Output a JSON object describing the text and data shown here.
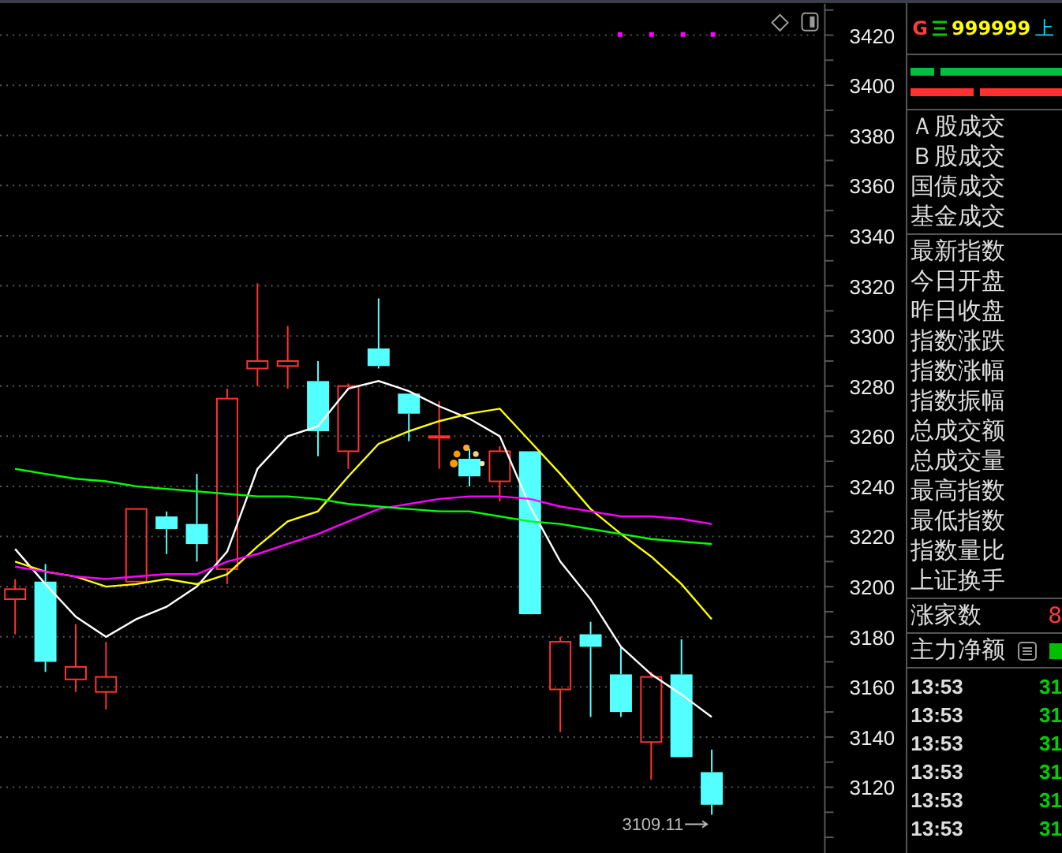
{
  "chart": {
    "chart_data": {
      "type": "candlestick",
      "grid": true,
      "ylim": [
        3094,
        3432.5
      ],
      "yticks": [
        3120,
        3140,
        3160,
        3180,
        3200,
        3220,
        3240,
        3260,
        3280,
        3300,
        3320,
        3340,
        3360,
        3380,
        3400,
        3420
      ],
      "ohlc": [
        [
          3195,
          3203,
          3181,
          3199
        ],
        [
          3202,
          3209,
          3166,
          3170
        ],
        [
          3163,
          3185,
          3158,
          3168
        ],
        [
          3158,
          3178,
          3151,
          3164
        ],
        [
          3202,
          3231,
          3202,
          3231
        ],
        [
          3228,
          3230,
          3213,
          3223
        ],
        [
          3225,
          3245,
          3210,
          3217
        ],
        [
          3207,
          3279,
          3201,
          3275
        ],
        [
          3287,
          3321,
          3280,
          3290
        ],
        [
          3288,
          3304,
          3279,
          3290
        ],
        [
          3282,
          3290,
          3252,
          3262
        ],
        [
          3254,
          3281,
          3247,
          3280
        ],
        [
          3295,
          3315,
          3287,
          3288
        ],
        [
          3277,
          3277,
          3258,
          3269
        ],
        [
          3260,
          3274,
          3247,
          3260
        ],
        [
          3251,
          3255,
          3240,
          3244
        ],
        [
          3242,
          3256,
          3234,
          3254
        ],
        [
          3254,
          3254,
          3189,
          3189
        ],
        [
          3159,
          3180,
          3142,
          3178
        ],
        [
          3181,
          3186,
          3148,
          3176
        ],
        [
          3165,
          3176,
          3148,
          3150
        ],
        [
          3138,
          3166,
          3123,
          3164
        ],
        [
          3165,
          3179,
          3132,
          3132
        ],
        [
          3126,
          3135,
          3109,
          3113
        ],
        null,
        null,
        null
      ],
      "series": [
        {
          "type": "line",
          "color": "#ffffff",
          "values": [
            3215,
            3201,
            3188,
            3180,
            3187,
            3192,
            3200,
            3214,
            3247,
            3260,
            3264,
            3279,
            3282,
            3278,
            3272,
            3267,
            3260,
            3232,
            3210,
            3195,
            3176,
            3165,
            3157,
            3148,
            null,
            null,
            null
          ]
        },
        {
          "type": "line",
          "color": "#ffff00",
          "values": [
            3210,
            3206,
            3204,
            3200,
            3201,
            3203,
            3201,
            3205,
            3216,
            3226,
            3230,
            3244,
            3257,
            3262,
            3266,
            3269,
            3271,
            3258,
            3245,
            3231,
            3221,
            3212,
            3201,
            3187,
            null,
            null,
            null
          ]
        },
        {
          "type": "line",
          "color": "#ff00ff",
          "values": [
            3208,
            3206,
            3204,
            3203,
            3204,
            3205,
            3205,
            3210,
            3213,
            3217,
            3221,
            3226,
            3231,
            3233,
            3235,
            3236,
            3236,
            3235,
            3232,
            3230,
            3228,
            3228,
            3227,
            3225,
            null,
            null,
            null
          ]
        },
        {
          "type": "line",
          "color": "#00ff00",
          "values": [
            3247,
            3245,
            3243,
            3242,
            3240,
            3239,
            3238,
            3237,
            3236,
            3236,
            3235,
            3233,
            3232,
            3231,
            3230,
            3230,
            3228,
            3226,
            3225,
            3223,
            3221,
            3219,
            3218,
            3217,
            null,
            null,
            null
          ]
        }
      ],
      "annotations": [
        {
          "text": "3109.11"
        }
      ]
    }
  },
  "quote_panel": {
    "header": {
      "flag": "G",
      "code": "999999",
      "name": "上"
    },
    "up_bar": {
      "level": 0.16
    },
    "down_bar": {
      "level": 0.43
    },
    "groups": [
      [
        "Ａ股成交",
        "Ｂ股成交",
        "国债成交",
        "基金成交"
      ],
      [
        "最新指数",
        "今日开盘",
        "昨日收盘",
        "指数涨跌",
        "指数涨幅",
        "指数振幅",
        "总成交额",
        "总成交量",
        "最高指数",
        "最低指数",
        "指数量比",
        "上证换手"
      ]
    ],
    "advance": {
      "label": "涨家数",
      "value": "8"
    },
    "main_flow": {
      "label": "主力净额"
    },
    "ticks": [
      {
        "time": "13:53",
        "value": "31"
      },
      {
        "time": "13:53",
        "value": "31"
      },
      {
        "time": "13:53",
        "value": "31"
      },
      {
        "time": "13:53",
        "value": "31"
      },
      {
        "time": "13:53",
        "value": "31"
      },
      {
        "time": "13:53",
        "value": "31"
      }
    ]
  }
}
